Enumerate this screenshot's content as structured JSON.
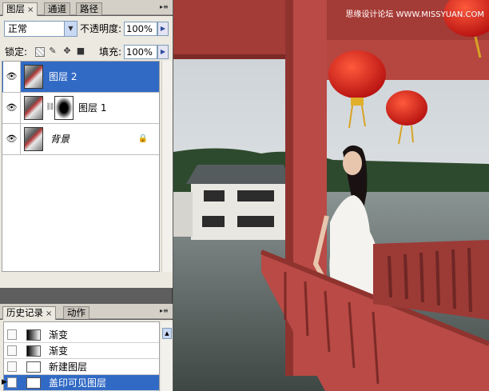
{
  "layers_panel": {
    "tabs": [
      {
        "label": "图层",
        "close": "×"
      },
      {
        "label": "通道"
      },
      {
        "label": "路径"
      }
    ],
    "blend_mode": "正常",
    "opacity_label": "不透明度:",
    "opacity_value": "100%",
    "lock_label": "锁定:",
    "fill_label": "填充:",
    "fill_value": "100%",
    "layers": [
      {
        "name": "图层 2",
        "selected": true
      },
      {
        "name": "图层 1",
        "selected": false,
        "has_mask": true
      },
      {
        "name": "背景",
        "selected": false,
        "locked": true
      }
    ]
  },
  "history_panel": {
    "tabs": [
      {
        "label": "历史记录",
        "close": "×"
      },
      {
        "label": "动作"
      }
    ],
    "items": [
      {
        "name": "渐变",
        "icon": "gradient-icon"
      },
      {
        "name": "渐变",
        "icon": "gradient-icon"
      },
      {
        "name": "新建图层",
        "icon": "document-icon"
      },
      {
        "name": "盖印可见图层",
        "icon": "document-icon",
        "selected": true
      }
    ]
  },
  "watermark": "思缘设计论坛 WWW.MISSYUAN.COM",
  "colors": {
    "selection": "#316ac5",
    "panel_bg": "#ece9e1",
    "pillar_red": "#b94a45",
    "lantern_red": "#d8251d"
  }
}
